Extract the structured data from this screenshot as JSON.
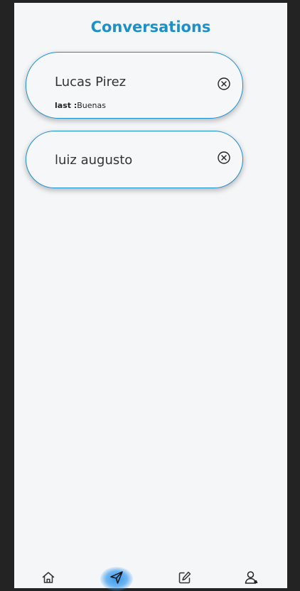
{
  "header": {
    "title": "Conversations"
  },
  "conversations": [
    {
      "name": "Lucas Pirez",
      "last_label": "last :",
      "last_message": "Buenas",
      "close_icon": "close-circle-icon"
    },
    {
      "name": "luiz augusto",
      "close_icon": "close-circle-icon"
    }
  ],
  "bottom_nav": {
    "items": [
      {
        "icon": "home-icon",
        "active": false
      },
      {
        "icon": "send-icon",
        "active": true
      },
      {
        "icon": "edit-icon",
        "active": false
      },
      {
        "icon": "user-icon",
        "active": false
      }
    ]
  },
  "colors": {
    "accent": "#1e90c8",
    "card_border": "#1c8fd0",
    "active_glow": "#2e94ee",
    "background": "#f5f6f8",
    "outer": "#232323"
  }
}
